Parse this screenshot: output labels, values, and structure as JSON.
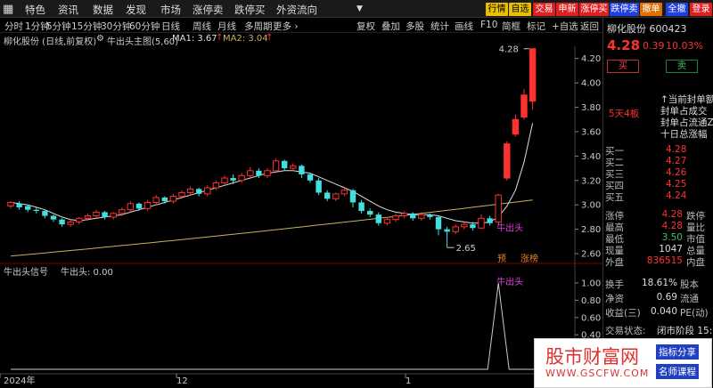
{
  "menu": {
    "items": [
      "特色",
      "资讯",
      "数据",
      "发现",
      "市场",
      "涨停卖",
      "跌停买",
      "外资流向"
    ],
    "dropdown": "▼",
    "top_buttons": [
      {
        "label": "行情",
        "style": "y"
      },
      {
        "label": "自选",
        "style": "y"
      },
      {
        "label": "交易",
        "style": "r"
      },
      {
        "label": "申新",
        "style": "r"
      },
      {
        "label": "涨停买",
        "style": "r"
      },
      {
        "label": "跌停卖",
        "style": "b"
      },
      {
        "label": "撤单",
        "style": "o"
      },
      {
        "label": "全撤",
        "style": "b"
      },
      {
        "label": "登录",
        "style": "r"
      }
    ]
  },
  "periods": [
    "分时",
    "1分钟",
    "5分钟",
    "15分钟",
    "30分钟",
    "60分钟",
    "日线",
    "周线",
    "月线",
    "多周期",
    "更多 ›"
  ],
  "right_tools": [
    "复权",
    "叠加",
    "多股",
    "统计",
    "画线",
    "F10",
    "简框",
    "标记",
    "+自选",
    "返回"
  ],
  "info": {
    "stock": "柳化股份 (日线,前复权)",
    "indicator": "牛出头主图(5,60)",
    "ma1": "MA1: 3.67",
    "ma1_arrow": "↑",
    "ma2": "MA2: 3.04",
    "ma2_arrow": "↑"
  },
  "lower_info": {
    "name": "牛出头信号",
    "value": "牛出头: 0.00"
  },
  "chart_data": {
    "type": "candlestick",
    "y_ticks": [
      "4.20",
      "4.00",
      "3.80",
      "3.60",
      "3.40",
      "3.20",
      "3.00",
      "2.80",
      "2.60"
    ],
    "lower_ticks": [
      "1.00",
      "0.80",
      "0.60",
      "0.40",
      "0.20"
    ],
    "x_ticks": [
      "2024年",
      "12",
      "1"
    ],
    "annotations": {
      "high": "4.28",
      "low": "2.65",
      "signal": "牛出头",
      "signal_lower": "牛出头",
      "pre": "预",
      "zt": "涨榜"
    },
    "colors": {
      "up": "#ff3030",
      "down": "#40e0e0",
      "ma1": "#e0e0e0",
      "ma2": "#c8b060"
    },
    "candles": [
      [
        2.99,
        3.02,
        2.97,
        3.03
      ],
      [
        3.01,
        2.98,
        2.96,
        3.03
      ],
      [
        2.99,
        2.96,
        2.94,
        3.0
      ],
      [
        2.96,
        2.95,
        2.93,
        2.98
      ],
      [
        2.95,
        2.91,
        2.89,
        2.96
      ],
      [
        2.91,
        2.88,
        2.86,
        2.92
      ],
      [
        2.88,
        2.84,
        2.82,
        2.89
      ],
      [
        2.84,
        2.86,
        2.82,
        2.88
      ],
      [
        2.86,
        2.89,
        2.84,
        2.9
      ],
      [
        2.89,
        2.91,
        2.87,
        2.93
      ],
      [
        2.91,
        2.94,
        2.89,
        2.96
      ],
      [
        2.94,
        2.9,
        2.88,
        2.95
      ],
      [
        2.9,
        2.93,
        2.88,
        2.94
      ],
      [
        2.93,
        2.96,
        2.91,
        2.98
      ],
      [
        2.96,
        3.01,
        2.94,
        3.03
      ],
      [
        3.01,
        2.97,
        2.95,
        3.02
      ],
      [
        2.97,
        3.02,
        2.95,
        3.04
      ],
      [
        3.02,
        3.06,
        3.0,
        3.08
      ],
      [
        3.06,
        3.03,
        3.01,
        3.07
      ],
      [
        3.03,
        3.07,
        3.01,
        3.09
      ],
      [
        3.07,
        3.1,
        3.05,
        3.12
      ],
      [
        3.1,
        3.13,
        3.08,
        3.15
      ],
      [
        3.13,
        3.09,
        3.07,
        3.14
      ],
      [
        3.09,
        3.14,
        3.07,
        3.16
      ],
      [
        3.14,
        3.18,
        3.12,
        3.2
      ],
      [
        3.18,
        3.22,
        3.16,
        3.24
      ],
      [
        3.22,
        3.2,
        3.17,
        3.25
      ],
      [
        3.2,
        3.24,
        3.18,
        3.26
      ],
      [
        3.24,
        3.28,
        3.22,
        3.31
      ],
      [
        3.28,
        3.24,
        3.22,
        3.3
      ],
      [
        3.24,
        3.28,
        3.22,
        3.3
      ],
      [
        3.28,
        3.36,
        3.26,
        3.38
      ],
      [
        3.36,
        3.3,
        3.28,
        3.37
      ],
      [
        3.3,
        3.32,
        3.28,
        3.34
      ],
      [
        3.32,
        3.25,
        3.22,
        3.33
      ],
      [
        3.25,
        3.2,
        3.18,
        3.26
      ],
      [
        3.2,
        3.1,
        3.08,
        3.22
      ],
      [
        3.1,
        3.05,
        3.03,
        3.12
      ],
      [
        3.05,
        3.09,
        3.03,
        3.1
      ],
      [
        3.09,
        3.12,
        3.07,
        3.14
      ],
      [
        3.12,
        3.02,
        2.98,
        3.13
      ],
      [
        3.02,
        2.95,
        2.93,
        3.04
      ],
      [
        2.95,
        2.92,
        2.9,
        2.97
      ],
      [
        2.92,
        2.85,
        2.83,
        2.94
      ],
      [
        2.85,
        2.88,
        2.83,
        2.9
      ],
      [
        2.88,
        2.91,
        2.86,
        2.93
      ],
      [
        2.91,
        2.93,
        2.89,
        2.95
      ],
      [
        2.93,
        2.89,
        2.87,
        2.94
      ],
      [
        2.89,
        2.92,
        2.87,
        2.94
      ],
      [
        2.92,
        2.9,
        2.88,
        2.93
      ],
      [
        2.9,
        2.8,
        2.75,
        2.91
      ],
      [
        2.8,
        2.78,
        2.65,
        2.82
      ],
      [
        2.78,
        2.82,
        2.76,
        2.84
      ],
      [
        2.82,
        2.84,
        2.8,
        2.86
      ],
      [
        2.84,
        2.81,
        2.79,
        2.86
      ],
      [
        2.81,
        2.89,
        2.8,
        2.92
      ],
      [
        2.89,
        2.85,
        2.83,
        2.91
      ],
      [
        2.86,
        3.08,
        2.84,
        3.09
      ],
      [
        3.22,
        3.5,
        3.2,
        3.52
      ],
      [
        3.58,
        3.7,
        3.56,
        3.74
      ],
      [
        3.72,
        3.9,
        3.7,
        3.95
      ],
      [
        3.85,
        4.28,
        3.78,
        4.28
      ]
    ],
    "ma1": [
      3.02,
      3.01,
      3.0,
      2.98,
      2.96,
      2.93,
      2.9,
      2.88,
      2.87,
      2.88,
      2.89,
      2.9,
      2.91,
      2.92,
      2.94,
      2.96,
      2.98,
      3.0,
      3.02,
      3.04,
      3.06,
      3.08,
      3.1,
      3.12,
      3.14,
      3.16,
      3.18,
      3.2,
      3.22,
      3.24,
      3.26,
      3.27,
      3.28,
      3.28,
      3.27,
      3.26,
      3.23,
      3.2,
      3.17,
      3.14,
      3.11,
      3.07,
      3.03,
      2.99,
      2.96,
      2.94,
      2.93,
      2.92,
      2.92,
      2.92,
      2.91,
      2.89,
      2.87,
      2.86,
      2.85,
      2.85,
      2.86,
      2.9,
      2.99,
      3.12,
      3.35,
      3.67
    ],
    "ma2_start": 2.58,
    "ma2_end": 3.04,
    "signal_index": 57
  },
  "side": {
    "name": "柳化股份",
    "code": "600423",
    "price": "4.28",
    "change": "0.39",
    "pct": "10.03%",
    "buy": "买",
    "sell": "卖",
    "limit_tag": "5天4板",
    "notes": [
      "↑当前封单额",
      "封单占成交",
      "封单占流通Z",
      "十日总涨幅"
    ],
    "bids": [
      {
        "label": "买一",
        "price": "4.28",
        "vol": ""
      },
      {
        "label": "买二",
        "price": "4.27",
        "vol": ""
      },
      {
        "label": "买三",
        "price": "4.26",
        "vol": ""
      },
      {
        "label": "买四",
        "price": "4.25",
        "vol": ""
      },
      {
        "label": "买五",
        "price": "4.24",
        "vol": ""
      }
    ],
    "stats": [
      {
        "l": "涨停",
        "v": "4.28",
        "c": "red",
        "l2": "跌停"
      },
      {
        "l": "最高",
        "v": "4.28",
        "c": "red",
        "l2": "量比"
      },
      {
        "l": "最低",
        "v": "3.50",
        "c": "grn",
        "l2": "市值"
      },
      {
        "l": "现量",
        "v": "1047",
        "c": "wh",
        "l2": "总量"
      },
      {
        "l": "外盘",
        "v": "836515",
        "c": "red",
        "l2": "内盘"
      }
    ],
    "stats2": [
      {
        "l": "换手",
        "v": "18.61%",
        "l2": "股本"
      },
      {
        "l": "净资",
        "v": "0.69",
        "l2": "流通"
      },
      {
        "l": "收益(三)",
        "v": "0.040",
        "l2": "PE(动)"
      }
    ],
    "status_label": "交易状态:",
    "status_value": "闭市阶段 15:0"
  },
  "watermark": {
    "main": "股市财富网",
    "url": "WWW.GSCFW.COM",
    "tag1": "指标分享",
    "tag2": "名师课程"
  }
}
